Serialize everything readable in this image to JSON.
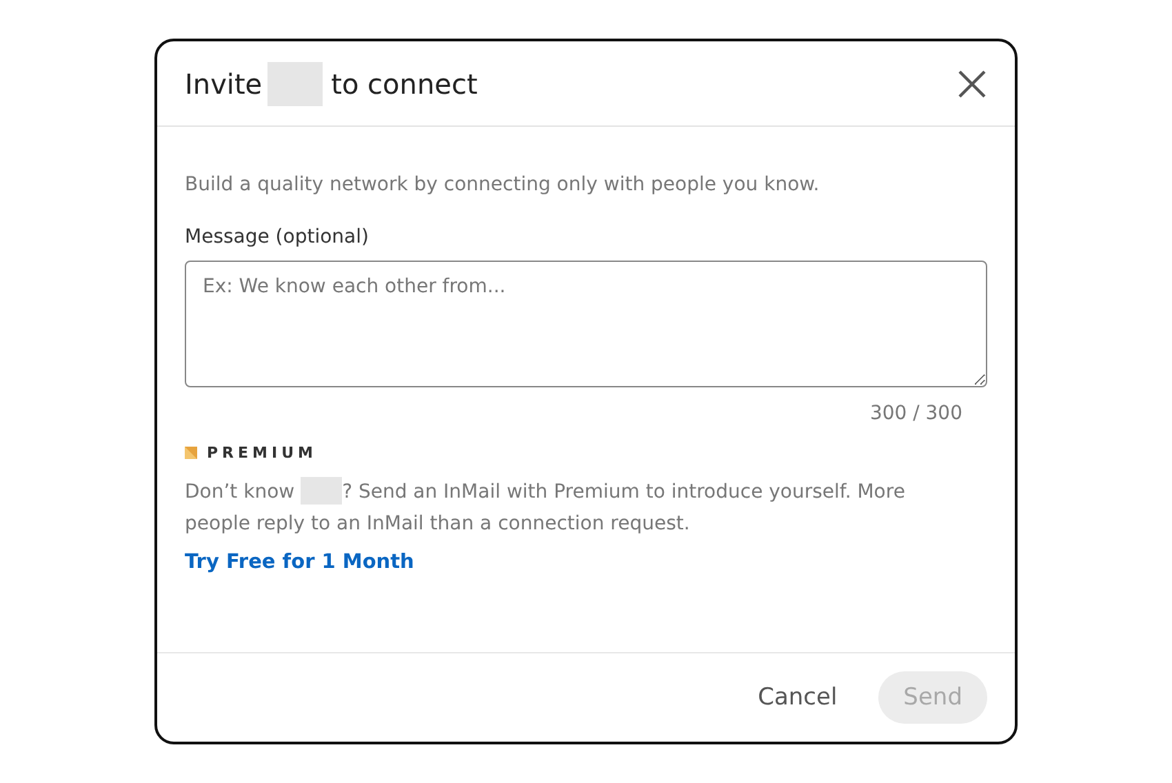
{
  "dialog": {
    "title_before": "Invite",
    "title_after": "to connect"
  },
  "intro": "Build a quality network by connecting only with people you know.",
  "message": {
    "label": "Message (optional)",
    "placeholder": "Ex: We know each other from...",
    "counter": "300 / 300"
  },
  "premium": {
    "badge": "PREMIUM",
    "text_before": "Don’t know",
    "text_after": "? Send an InMail with Premium to introduce yourself. More people reply to an InMail than a connection request.",
    "link": "Try Free for 1 Month"
  },
  "buttons": [
    {
      "label": "Cancel",
      "kind": "text",
      "disabled": false
    },
    {
      "label": "Send",
      "kind": "primary",
      "disabled": true
    }
  ]
}
